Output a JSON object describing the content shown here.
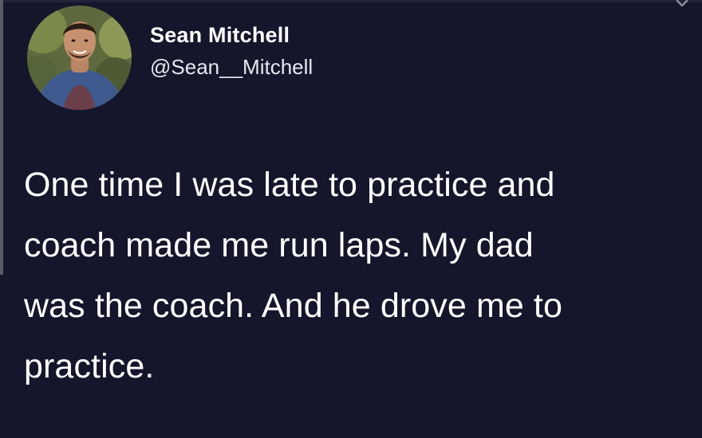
{
  "author": {
    "display_name": "Sean Mitchell",
    "handle": "@Sean__Mitchell",
    "avatar_icon": "profile-photo-avatar"
  },
  "tweet": {
    "text": "One time I was late to practice and\ncoach made me run laps. My dad\nwas the coach. And he drove me to\npractice."
  },
  "menu": {
    "icon": "chevron-down-icon"
  },
  "colors": {
    "background": "#15162b",
    "text": "#ffffff",
    "muted": "#8b8d99"
  }
}
